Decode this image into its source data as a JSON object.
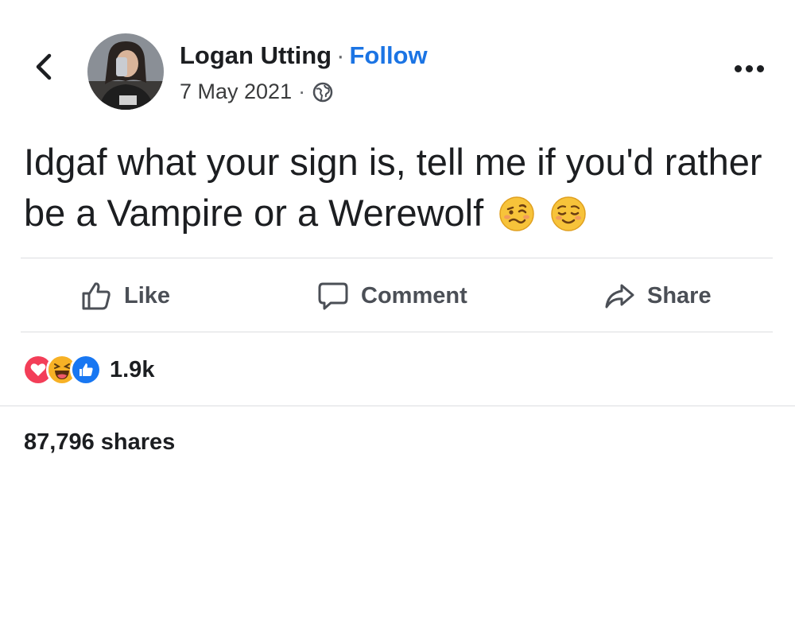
{
  "post": {
    "author": "Logan Utting",
    "separator": "·",
    "follow_label": "Follow",
    "date": "7 May 2021",
    "text": "Idgaf what your sign is, tell me if you'd rather be a Vampire or a Werewolf",
    "emojis": [
      "woozy-face",
      "relieved-face"
    ]
  },
  "actions": {
    "like_label": "Like",
    "comment_label": "Comment",
    "share_label": "Share"
  },
  "reactions": {
    "types": [
      "love",
      "haha",
      "like"
    ],
    "count": "1.9k"
  },
  "shares": "87,796 shares",
  "colors": {
    "follow": "#1b74e4",
    "love": "#f33e58",
    "like": "#1877f2",
    "haha": "#f7b125"
  }
}
